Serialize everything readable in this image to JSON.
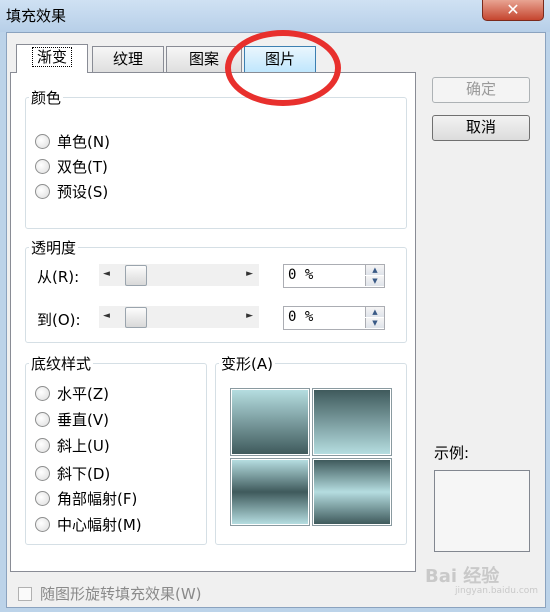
{
  "window": {
    "title": "填充效果",
    "close_glyph": "✕"
  },
  "tabs": [
    {
      "label": "渐变",
      "state": "active"
    },
    {
      "label": "纹理",
      "state": "normal"
    },
    {
      "label": "图案",
      "state": "normal"
    },
    {
      "label": "图片",
      "state": "hover"
    }
  ],
  "color_group": {
    "title": "颜色",
    "options": [
      "单色(N)",
      "双色(T)",
      "预设(S)"
    ]
  },
  "transparency_group": {
    "title": "透明度",
    "from": {
      "label": "从(R):",
      "value": "0 %",
      "level": 0
    },
    "to": {
      "label": "到(O):",
      "value": "0 %",
      "level": 0
    },
    "left_arrow": "◄",
    "right_arrow": "►",
    "up_arrow": "▲",
    "down_arrow": "▼"
  },
  "shading_group": {
    "title": "底纹样式",
    "options": [
      "水平(Z)",
      "垂直(V)",
      "斜上(U)",
      "斜下(D)",
      "角部幅射(F)",
      "中心幅射(M)"
    ]
  },
  "variants_group": {
    "title": "变形(A)"
  },
  "buttons": {
    "ok": "确定",
    "cancel": "取消"
  },
  "sample": {
    "label": "示例:"
  },
  "rotate_checkbox": {
    "label": "随图形旋转填充效果(W)",
    "checked": false
  },
  "colors": {
    "annotation_circle": "#e8302d",
    "swatch_light": "#b5dde0",
    "swatch_dark": "#3f5a5c"
  },
  "watermark": {
    "text": "Bai 经验",
    "sub": "jingyan.baidu.com"
  }
}
